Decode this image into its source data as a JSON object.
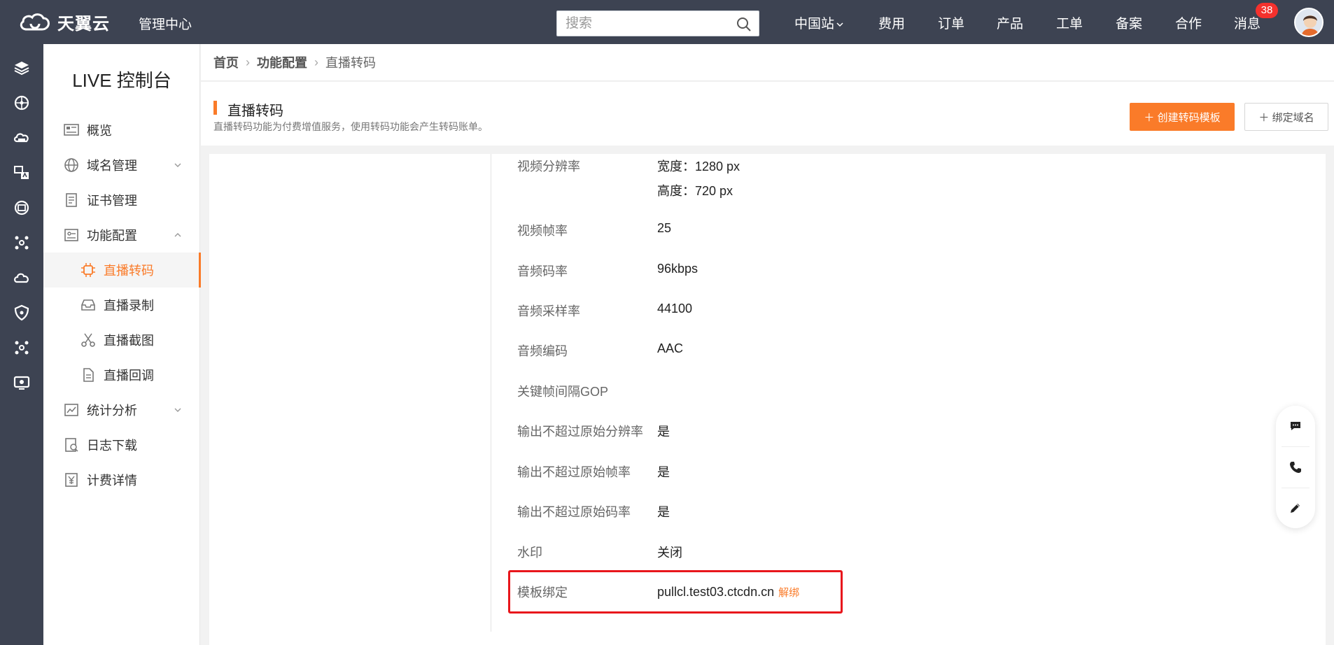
{
  "topbar": {
    "logo_text": "天翼云",
    "console_label": "管理中心",
    "search_placeholder": "搜索",
    "nav": [
      "中国站",
      "费用",
      "订单",
      "产品",
      "工单",
      "备案",
      "合作",
      "消息"
    ],
    "message_badge": "38"
  },
  "sidebar": {
    "title": "LIVE 控制台",
    "items": [
      {
        "label": "概览",
        "icon": "overview-icon"
      },
      {
        "label": "域名管理",
        "icon": "globe-icon"
      },
      {
        "label": "证书管理",
        "icon": "certificate-icon"
      },
      {
        "label": "功能配置",
        "icon": "settings-panel-icon"
      },
      {
        "label": "直播转码",
        "icon": "chip-icon"
      },
      {
        "label": "直播录制",
        "icon": "inbox-icon"
      },
      {
        "label": "直播截图",
        "icon": "scissors-icon"
      },
      {
        "label": "直播回调",
        "icon": "document-icon"
      },
      {
        "label": "统计分析",
        "icon": "chart-icon"
      },
      {
        "label": "日志下载",
        "icon": "log-icon"
      },
      {
        "label": "计费详情",
        "icon": "yen-icon"
      }
    ]
  },
  "breadcrumb": [
    "首页",
    "功能配置",
    "直播转码"
  ],
  "page": {
    "title": "直播转码",
    "description": "直播转码功能为付费增值服务，使用转码功能会产生转码账单。",
    "create_button": "＋ 创建转码模板",
    "bind_button": "＋ 绑定域名"
  },
  "details": {
    "resolution_label": "视频分辨率",
    "resolution_width": "宽度：1280 px",
    "resolution_height": "高度：720 px",
    "framerate_label": "视频帧率",
    "framerate_value": "25",
    "audio_bitrate_label": "音频码率",
    "audio_bitrate_value": "96kbps",
    "sample_rate_label": "音频采样率",
    "sample_rate_value": "44100",
    "audio_codec_label": "音频编码",
    "audio_codec_value": "AAC",
    "gop_label": "关键帧间隔GOP",
    "gop_value": "",
    "limit_resolution_label": "输出不超过原始分辨率",
    "limit_resolution_value": "是",
    "limit_framerate_label": "输出不超过原始帧率",
    "limit_framerate_value": "是",
    "limit_bitrate_label": "输出不超过原始码率",
    "limit_bitrate_value": "是",
    "watermark_label": "水印",
    "watermark_value": "关闭",
    "binding_label": "模板绑定",
    "binding_domain": "pullcl.test03.ctcdn.cn",
    "unbind_label": "解绑"
  },
  "colors": {
    "topbar_bg": "#3d4352",
    "accent": "#fa7b29",
    "highlight_border": "#e8161c"
  }
}
